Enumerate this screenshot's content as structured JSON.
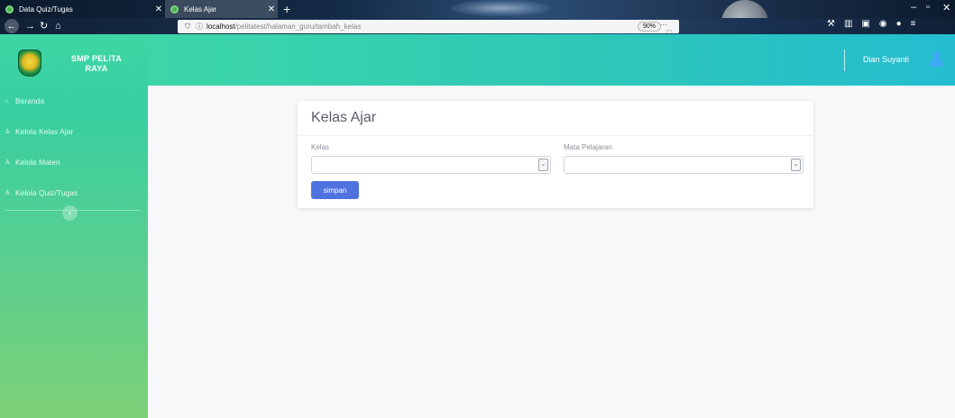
{
  "browser": {
    "tabs": [
      {
        "title": "Data Quiz/Tugas",
        "active": false
      },
      {
        "title": "Kelas Ajar",
        "active": true
      }
    ],
    "new_tab": "+",
    "url_host": "localhost",
    "url_path": "/pelitatest/halaman_guru/tambah_kelas",
    "zoom": "90%"
  },
  "brand": {
    "name_line1": "SMP PELITA",
    "name_line2": "RAYA"
  },
  "sidebar": {
    "items": [
      {
        "label": "Beranda",
        "icon": "home-icon"
      },
      {
        "label": "Kelola Kelas Ajar",
        "icon": "user-icon"
      },
      {
        "label": "Kelola Materi",
        "icon": "user-icon"
      },
      {
        "label": "Kelola Quiz/Tugas",
        "icon": "user-icon"
      }
    ]
  },
  "topbar": {
    "user_name": "Dian Suyanti"
  },
  "form": {
    "title": "Kelas Ajar",
    "kelas_label": "Kelas",
    "kelas_value": "",
    "mapel_label": "Mata Pelajaran",
    "mapel_value": "",
    "save_label": "simpan"
  },
  "colors": {
    "sidebar_top": "#3fd6a6",
    "sidebar_bottom": "#7dd077",
    "topbar_right": "#24bdd0",
    "primary_button": "#4e73df"
  }
}
